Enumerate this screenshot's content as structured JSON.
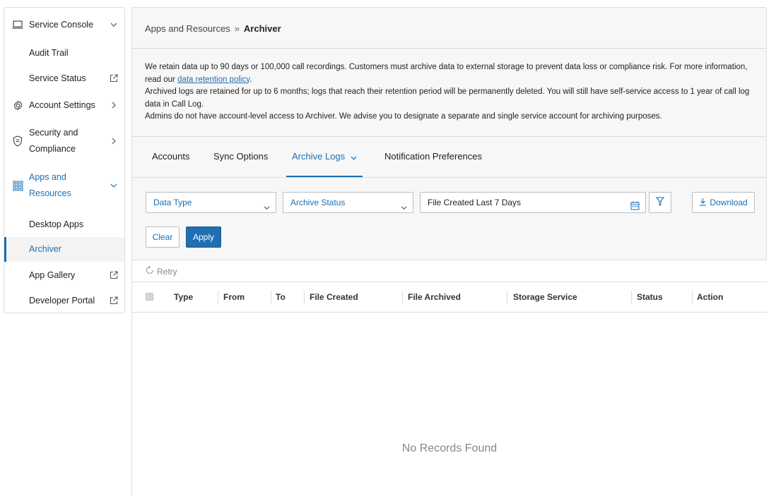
{
  "sidebar": {
    "items": [
      {
        "label": "Service Console",
        "icon": "laptop-icon",
        "trail": "chevron-down-icon"
      },
      {
        "label": "Audit Trail"
      },
      {
        "label": "Service Status",
        "trail": "external-link-icon"
      },
      {
        "label": "Account Settings",
        "icon": "gear-icon",
        "trail": "chevron-right-icon"
      },
      {
        "label": "Security and Compliance",
        "icon": "shield-icon",
        "trail": "chevron-right-icon"
      },
      {
        "label": "Apps and Resources",
        "icon": "grid-icon",
        "trail": "chevron-down-icon",
        "expanded": true
      },
      {
        "label": "Desktop Apps"
      },
      {
        "label": "Archiver",
        "active": true
      },
      {
        "label": "App Gallery",
        "trail": "external-link-icon"
      },
      {
        "label": "Developer Portal",
        "trail": "external-link-icon"
      }
    ]
  },
  "breadcrumb": {
    "parent": "Apps and Resources",
    "separator": "»",
    "current": "Archiver"
  },
  "info": {
    "line1_before_link": "We retain data up to 90 days or 100,000 call recordings. Customers must archive data to external storage to prevent data loss or compliance risk. For more information, read our ",
    "link": "data retention policy",
    "line1_after_link": ".",
    "line2": "Archived logs are retained for up to 6 months; logs that reach their retention period will be permanently deleted. You will still have self-service access to 1 year of call log data in Call Log.",
    "line3": "Admins do not have account-level access to Archiver. We advise you to designate a separate and single service account for archiving purposes."
  },
  "tabs": [
    {
      "label": "Accounts"
    },
    {
      "label": "Sync Options"
    },
    {
      "label": "Archive Logs",
      "active": true
    },
    {
      "label": "Notification Preferences"
    }
  ],
  "filters": {
    "data_type": "Data Type",
    "archive_status": "Archive Status",
    "date_range": "File Created Last 7 Days",
    "download": "Download",
    "clear": "Clear",
    "apply": "Apply"
  },
  "retry": "Retry",
  "table": {
    "columns": [
      "Type",
      "From",
      "To",
      "File Created",
      "File Archived",
      "Storage Service",
      "Status",
      "Action"
    ],
    "empty_message": "No Records Found"
  },
  "colors": {
    "accent": "#1a6fb5",
    "apply_bg": "#1f6fb2",
    "panel_bg": "#f7f7f7",
    "border": "#dcdcdc"
  }
}
